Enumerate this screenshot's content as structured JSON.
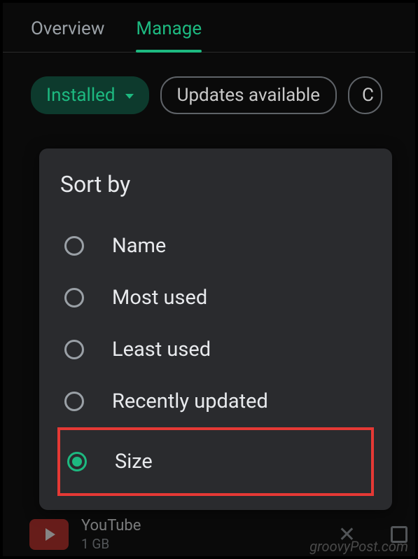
{
  "tabs": {
    "overview": "Overview",
    "manage": "Manage"
  },
  "chips": {
    "installed": "Installed",
    "updates": "Updates available",
    "partial": "C"
  },
  "sort": {
    "title": "Sort by",
    "options": {
      "name": "Name",
      "most_used": "Most used",
      "least_used": "Least used",
      "recently_updated": "Recently updated",
      "size": "Size"
    }
  },
  "app": {
    "name": "YouTube",
    "size": "1 GB"
  },
  "watermark": "groovyPost.com"
}
